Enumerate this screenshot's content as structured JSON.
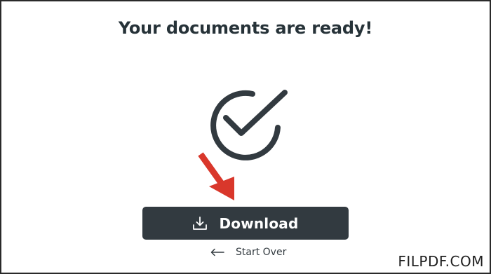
{
  "heading": "Your documents are ready!",
  "status_icon": "check-circle-icon",
  "pointer_icon": "red-arrow-icon",
  "download_button": {
    "icon": "download-icon",
    "label": "Download"
  },
  "start_over": {
    "icon": "arrow-left-icon",
    "label": "Start Over"
  },
  "watermark": "FILPDF.COM",
  "colors": {
    "dark": "#323a40",
    "heading": "#263238",
    "arrow": "#d9372b",
    "background": "#ffffff"
  }
}
